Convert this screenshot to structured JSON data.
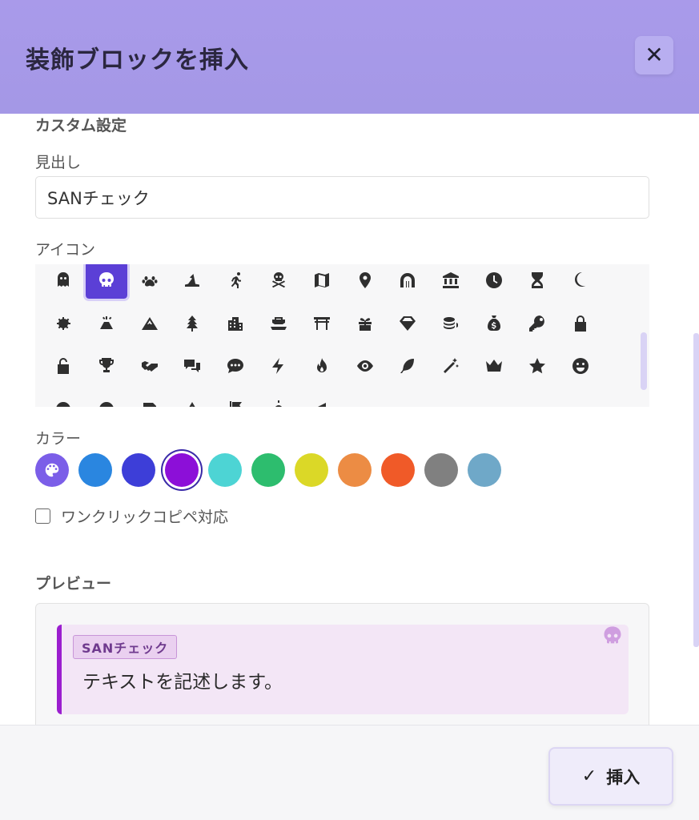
{
  "dialog": {
    "title": "装飾ブロックを挿入",
    "close_label": "✕"
  },
  "form": {
    "custom_section_title": "カスタム設定",
    "heading_label": "見出し",
    "heading_value": "SANチェック",
    "icon_label": "アイコン",
    "color_label": "カラー",
    "one_click_label": "ワンクリックコピペ対応",
    "one_click_checked": false,
    "preview_title": "プレビュー"
  },
  "icons": [
    "ghost-icon",
    "skull-icon",
    "paw-icon",
    "witch-hat-icon",
    "running-icon",
    "skull-crossbones-icon",
    "map-icon",
    "map-pin-icon",
    "dungeon-icon",
    "landmark-icon",
    "clock-icon",
    "hourglass-icon",
    "moon-icon",
    "cog-icon",
    "volcano-icon",
    "mountain-icon",
    "tree-icon",
    "city-icon",
    "ship-icon",
    "torii-icon",
    "gift-icon",
    "gem-icon",
    "coins-icon",
    "money-bag-icon",
    "key-icon",
    "lock-icon",
    "unlock-icon",
    "trophy-icon",
    "handshake-icon",
    "comments-icon",
    "comment-dots-icon",
    "bolt-icon",
    "fire-icon",
    "eye-icon",
    "feather-icon",
    "magic-wand-icon",
    "crown-icon",
    "star-icon",
    "smile-icon",
    "circle-icon",
    "circle-icon",
    "paper-icon",
    "tent-icon",
    "flag-icon",
    "sun-icon",
    "bullhorn-icon"
  ],
  "selected_icon_index": 1,
  "colors": {
    "swatches": [
      "#7b5ee8",
      "#2a86e0",
      "#3d3ed8",
      "#8c0fd8",
      "#4dd4d4",
      "#2dbd6e",
      "#dbd827",
      "#ec8c44",
      "#f05a28",
      "#808080",
      "#6fa8c8"
    ],
    "selected_index": 3
  },
  "preview": {
    "tag": "SANチェック",
    "text": "テキストを記述します。",
    "accent": "#9b1fcf"
  },
  "footer": {
    "insert_label": "挿入",
    "check_glyph": "✓"
  }
}
